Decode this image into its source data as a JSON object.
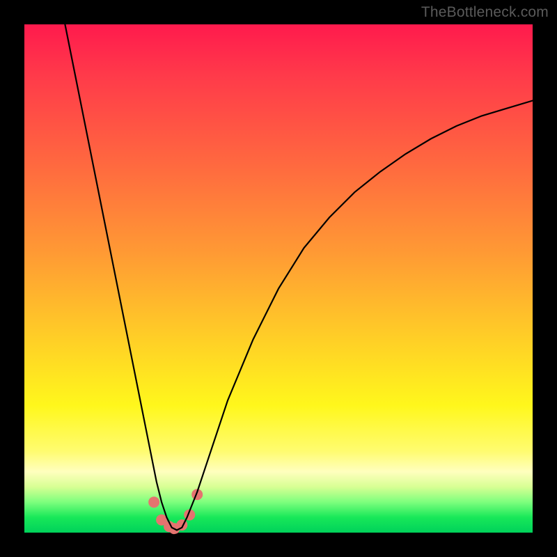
{
  "watermark": "TheBottleneck.com",
  "chart_data": {
    "type": "line",
    "title": "",
    "xlabel": "",
    "ylabel": "",
    "xlim": [
      0,
      100
    ],
    "ylim": [
      0,
      100
    ],
    "series": [
      {
        "name": "bottleneck-curve",
        "x": [
          8,
          10,
          12,
          14,
          16,
          18,
          20,
          22,
          24,
          26,
          27,
          28,
          29,
          30,
          31,
          32,
          34,
          36,
          40,
          45,
          50,
          55,
          60,
          65,
          70,
          75,
          80,
          85,
          90,
          95,
          100
        ],
        "values": [
          100,
          90,
          80,
          70,
          60,
          50,
          40,
          30,
          20,
          10,
          6,
          3,
          1,
          0.5,
          1,
          3,
          8,
          14,
          26,
          38,
          48,
          56,
          62,
          67,
          71,
          74.5,
          77.5,
          80,
          82,
          83.5,
          85
        ]
      }
    ],
    "markers": {
      "name": "trough-dots",
      "x": [
        25.5,
        27.0,
        28.5,
        29.5,
        31.0,
        32.5,
        34.0
      ],
      "values": [
        6.0,
        2.5,
        1.2,
        0.8,
        1.5,
        3.5,
        7.5
      ],
      "color": "#e5736f",
      "radius": 8
    }
  }
}
